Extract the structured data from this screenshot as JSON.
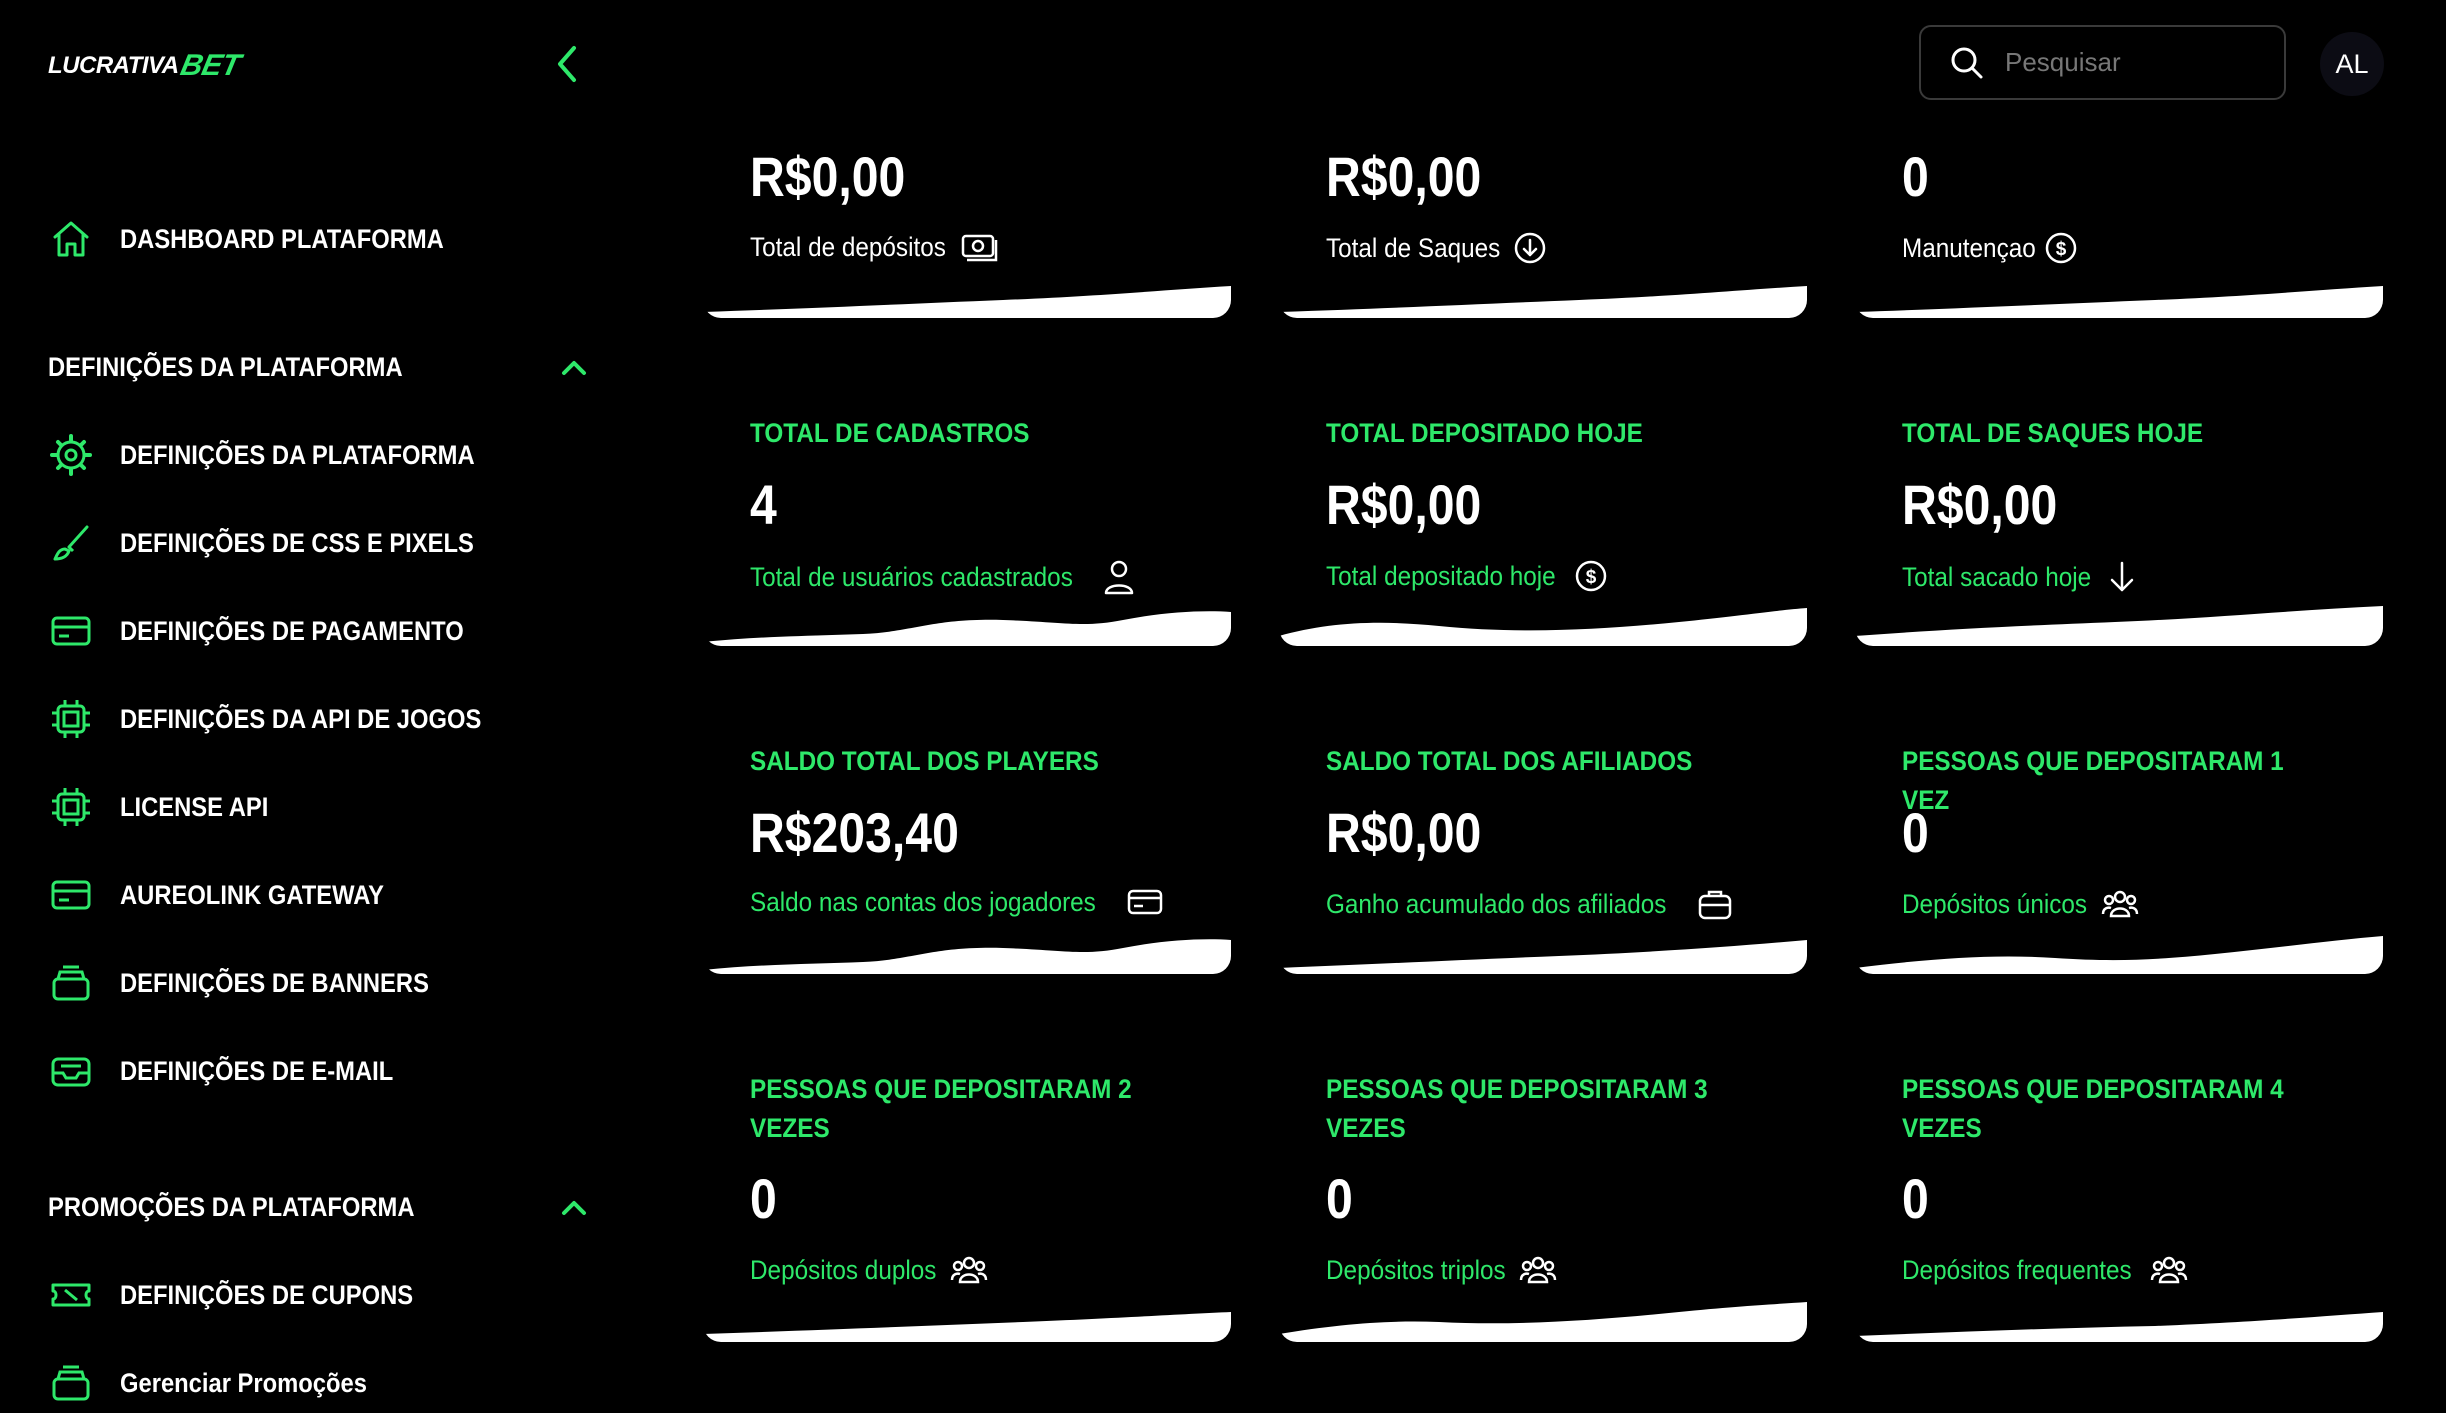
{
  "header": {
    "logo_text": "LUCRATIVA",
    "logo_accent": "BET",
    "search_placeholder": "Pesquisar",
    "avatar_initials": "AL"
  },
  "sidebar": {
    "dashboard_label": "DASHBOARD PLATAFORMA",
    "section_settings": "DEFINIÇÕES DA PLATAFORMA",
    "settings_items": [
      {
        "label": "DEFINIÇÕES DA PLATAFORMA",
        "icon": "gear-icon"
      },
      {
        "label": "DEFINIÇÕES DE CSS E PIXELS",
        "icon": "brush-icon"
      },
      {
        "label": "DEFINIÇÕES DE PAGAMENTO",
        "icon": "credit-card-icon"
      },
      {
        "label": "DEFINIÇÕES DA API DE JOGOS",
        "icon": "chip-icon"
      },
      {
        "label": "LICENSE API",
        "icon": "chip-icon"
      },
      {
        "label": "AUREOLINK GATEWAY",
        "icon": "credit-card-icon"
      },
      {
        "label": "DEFINIÇÕES DE BANNERS",
        "icon": "stack-icon"
      },
      {
        "label": "DEFINIÇÕES DE E-MAIL",
        "icon": "inbox-icon"
      }
    ],
    "section_promotions": "PROMOÇÕES DA PLATAFORMA",
    "promo_items": [
      {
        "label": "DEFINIÇÕES DE CUPONS",
        "icon": "ticket-icon"
      },
      {
        "label": "Gerenciar Promoções",
        "icon": "stack-icon"
      }
    ]
  },
  "cards": {
    "deposits": {
      "value": "R$0,00",
      "sub": "Total de depósitos",
      "icon": "cash-icon"
    },
    "withdrawals": {
      "value": "R$0,00",
      "sub": "Total de Saques",
      "icon": "arrow-down-circle-icon"
    },
    "maintenance": {
      "value": "0",
      "sub": "Manutençao",
      "icon": "dollar-circle-icon"
    },
    "signups": {
      "title": "TOTAL DE CADASTROS",
      "value": "4",
      "sub": "Total de usuários cadastrados",
      "icon": "user-icon"
    },
    "deposited_today": {
      "title": "TOTAL DEPOSITADO HOJE",
      "value": "R$0,00",
      "sub": "Total depositado hoje",
      "icon": "dollar-circle-icon"
    },
    "withdrawals_today": {
      "title": "TOTAL DE SAQUES HOJE",
      "value": "R$0,00",
      "sub": "Total sacado hoje",
      "icon": "arrow-down-icon"
    },
    "players_balance": {
      "title": "SALDO TOTAL DOS PLAYERS",
      "value": "R$203,40",
      "sub": "Saldo nas contas dos jogadores",
      "icon": "credit-card-icon"
    },
    "affiliates_balance": {
      "title": "SALDO TOTAL DOS AFILIADOS",
      "value": "R$0,00",
      "sub": "Ganho acumulado dos afiliados",
      "icon": "briefcase-icon"
    },
    "deposited_once": {
      "title": "PESSOAS QUE DEPOSITARAM 1 VEZ",
      "value": "0",
      "sub": "Depósitos únicos",
      "icon": "users-icon"
    },
    "deposited_twice": {
      "title": "PESSOAS QUE DEPOSITARAM 2 VEZES",
      "value": "0",
      "sub": "Depósitos duplos",
      "icon": "users-icon"
    },
    "deposited_thrice": {
      "title": "PESSOAS QUE DEPOSITARAM 3 VEZES",
      "value": "0",
      "sub": "Depósitos triplos",
      "icon": "users-icon"
    },
    "deposited_four": {
      "title": "PESSOAS QUE DEPOSITARAM 4 VEZES",
      "value": "0",
      "sub": "Depósitos frequentes",
      "icon": "users-icon"
    }
  },
  "colors": {
    "accent": "#2ee86a",
    "background": "#000000",
    "text": "#ffffff"
  }
}
